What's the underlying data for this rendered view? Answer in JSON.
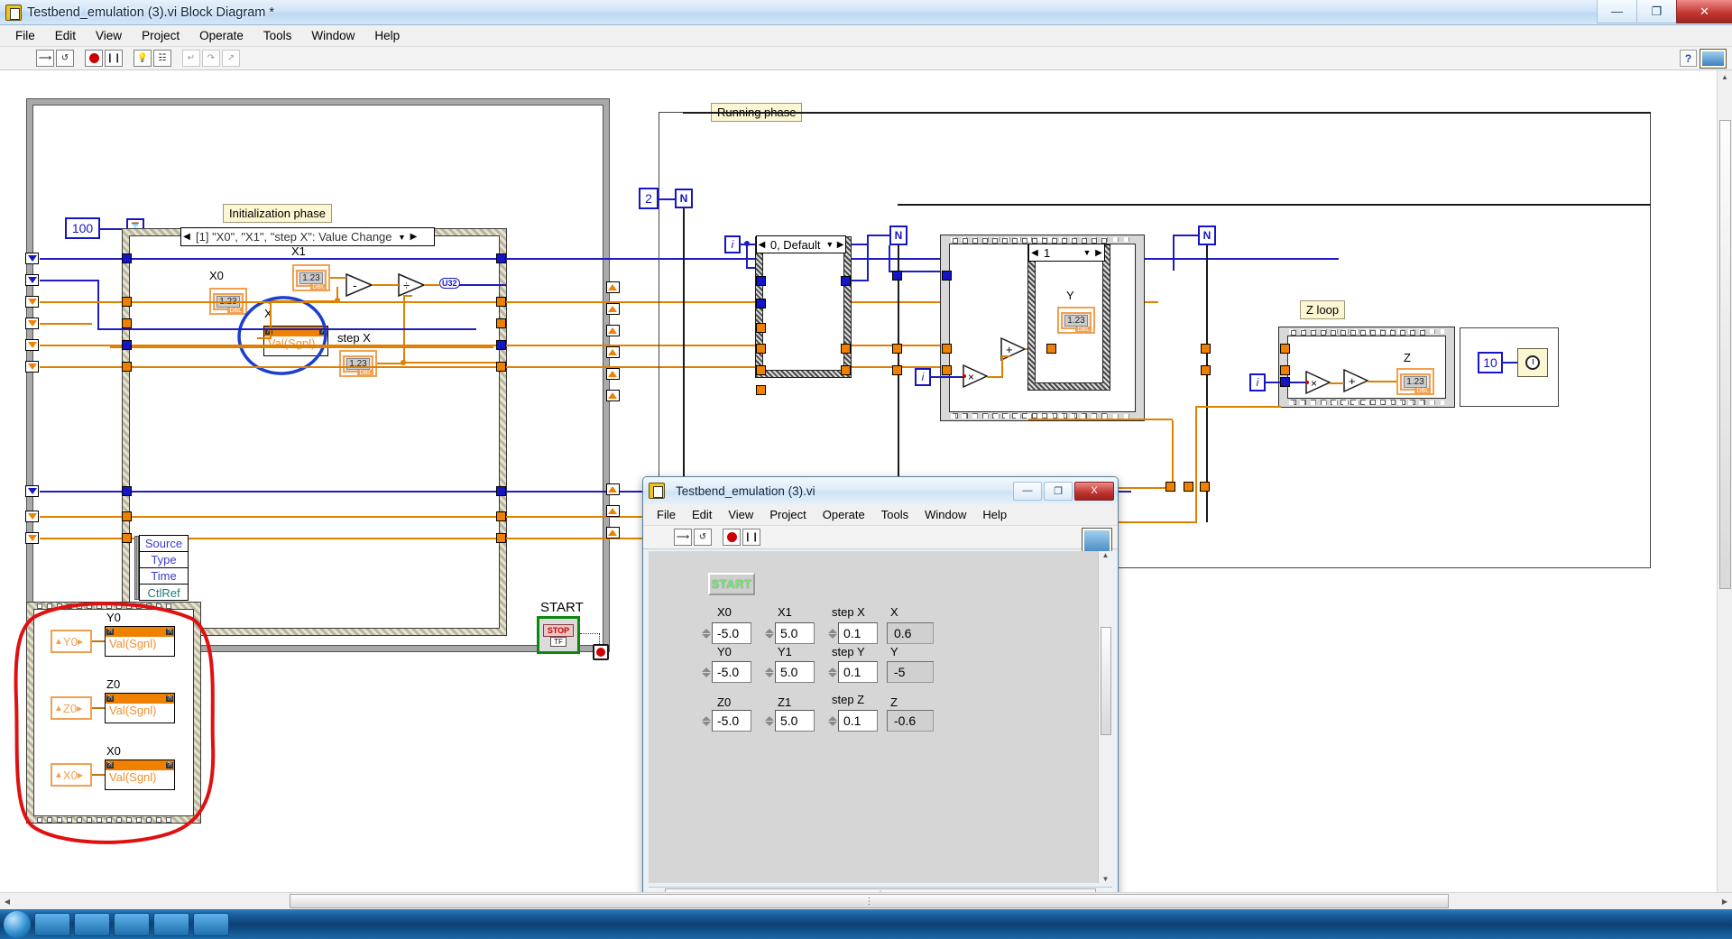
{
  "window": {
    "title": "Testbend_emulation (3).vi Block Diagram *",
    "icon": "labview-vi-icon",
    "buttons": {
      "minimize": "—",
      "maximize": "❐",
      "close": "✕"
    }
  },
  "menu": {
    "items": [
      "File",
      "Edit",
      "View",
      "Project",
      "Operate",
      "Tools",
      "Window",
      "Help"
    ]
  },
  "toolbar": {
    "run": "run-arrow-icon",
    "run_continuous": "run-continuous-icon",
    "abort": "abort-execution-icon",
    "pause": "pause-icon",
    "highlight": "highlight-execution-bulb-icon",
    "retain_values": "retain-wire-values-icon",
    "step_into": "step-into-icon",
    "step_over": "step-over-icon",
    "step_out": "step-out-icon",
    "help": "context-help-icon",
    "vi_icon": "vi-glyph-icon"
  },
  "diagram": {
    "labels": {
      "init_phase": "Initialization phase",
      "running_phase": "Running phase",
      "z_loop": "Z loop",
      "start": "START"
    },
    "event_case": "[1] \"X0\", \"X1\", \"step X\": Value Change",
    "case_default": "0, Default",
    "case_one": "1",
    "constants": {
      "hundred": "100",
      "two": "2",
      "ten": "10"
    },
    "iterators": {
      "i": "i",
      "N": "N"
    },
    "coercion": {
      "u32": "U32"
    },
    "init_controls": [
      {
        "name": "X0",
        "type": "DBL",
        "glyph": "1.23"
      },
      {
        "name": "X1",
        "type": "DBL",
        "glyph": "1.23"
      },
      {
        "name": "step X",
        "type": "DBL",
        "glyph": "1.23"
      }
    ],
    "init_property_node": {
      "name": "X",
      "method": "Val(Sgnl)"
    },
    "running_indicators": [
      {
        "name": "Y",
        "type": "DBL",
        "glyph": "1.23"
      },
      {
        "name": "Z",
        "type": "DBL",
        "glyph": "1.23"
      }
    ],
    "event_data_cluster": {
      "rows": [
        "Source",
        "Type",
        "Time",
        "CtlRef"
      ]
    },
    "stop_node": {
      "label": "STOP",
      "bool": "TF"
    },
    "wait_node": "wait-ms-timer-icon",
    "bottom_group": {
      "items": [
        {
          "label": "Y0",
          "ref": "Y0",
          "method": "Val(Sgnl)"
        },
        {
          "label": "Z0",
          "ref": "Z0",
          "method": "Val(Sgnl)"
        },
        {
          "label": "X0",
          "ref": "X0",
          "method": "Val(Sgnl)"
        }
      ]
    },
    "annotations": {
      "blue_circle": "blue-hand-drawn-ellipse",
      "red_circle": "red-hand-drawn-ellipse"
    },
    "operators": {
      "subtract": "-",
      "divide": "÷",
      "multiply": "×",
      "add": "+"
    }
  },
  "front_panel": {
    "title": "Testbend_emulation (3).vi",
    "menu": [
      "File",
      "Edit",
      "View",
      "Project",
      "Operate",
      "Tools",
      "Window",
      "Help"
    ],
    "start_button": "START",
    "rows": [
      {
        "controls": [
          {
            "label": "X0",
            "value": "-5.0",
            "kind": "control"
          },
          {
            "label": "X1",
            "value": "5.0",
            "kind": "control"
          },
          {
            "label": "step X",
            "value": "0.1",
            "kind": "control"
          },
          {
            "label": "X",
            "value": "0.6",
            "kind": "indicator"
          }
        ]
      },
      {
        "controls": [
          {
            "label": "Y0",
            "value": "-5.0",
            "kind": "control"
          },
          {
            "label": "Y1",
            "value": "5.0",
            "kind": "control"
          },
          {
            "label": "step Y",
            "value": "0.1",
            "kind": "control"
          },
          {
            "label": "Y",
            "value": "-5",
            "kind": "indicator"
          }
        ]
      },
      {
        "controls": [
          {
            "label": "Z0",
            "value": "-5.0",
            "kind": "control"
          },
          {
            "label": "Z1",
            "value": "5.0",
            "kind": "control"
          },
          {
            "label": "step Z",
            "value": "0.1",
            "kind": "control"
          },
          {
            "label": "Z",
            "value": "-0.6",
            "kind": "indicator"
          }
        ]
      }
    ],
    "buttons": {
      "minimize": "—",
      "maximize": "❐",
      "close": "X"
    }
  },
  "colors": {
    "wire_blue": "#1c1cc0",
    "wire_orange": "#e08000",
    "accent_orange": "#f08000",
    "annotation_blue": "#1a3fd0",
    "annotation_red": "#e01010",
    "label_bg": "#fdf6d3"
  }
}
